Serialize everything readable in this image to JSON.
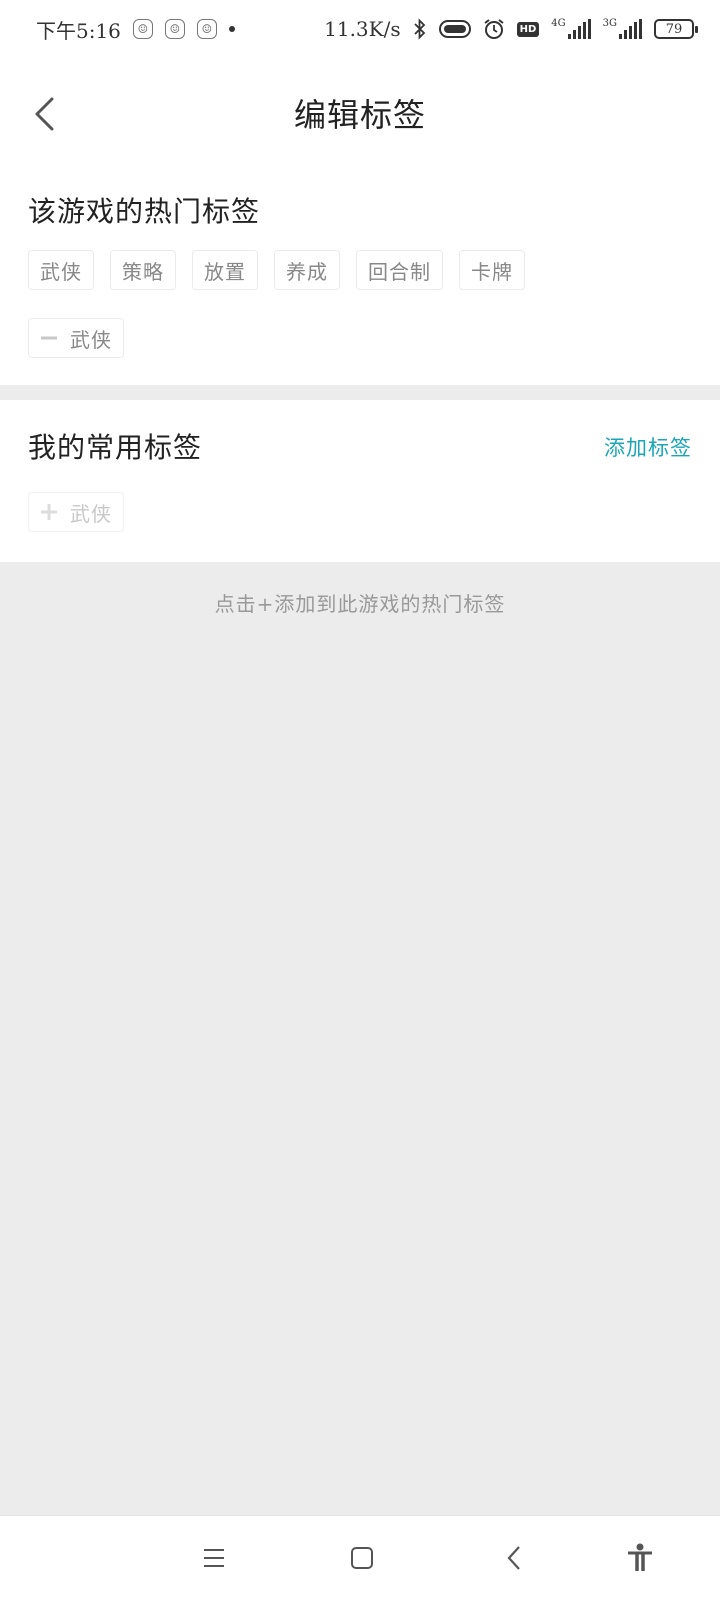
{
  "status_bar": {
    "time": "下午5:16",
    "net_speed": "11.3K/s",
    "network_4g": "4G",
    "network_3g": "3G",
    "hd": "HD",
    "battery": "79"
  },
  "header": {
    "title": "编辑标签"
  },
  "hot_tags": {
    "title": "该游戏的热门标签",
    "tags": [
      "武侠",
      "策略",
      "放置",
      "养成",
      "回合制",
      "卡牌"
    ],
    "selected": [
      "武侠"
    ]
  },
  "my_tags": {
    "title": "我的常用标签",
    "add_label": "添加标签",
    "tags": [
      "武侠"
    ]
  },
  "hint": "点击+添加到此游戏的热门标签",
  "colors": {
    "accent": "#1aa6b7",
    "background": "#ececec",
    "tag_text": "#888888"
  }
}
